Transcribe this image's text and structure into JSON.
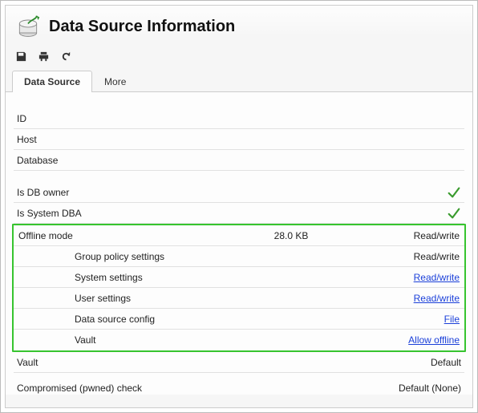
{
  "header": {
    "title": "Data Source Information"
  },
  "tabs": {
    "data_source": "Data Source",
    "more": "More"
  },
  "fields": {
    "id_label": "ID",
    "host_label": "Host",
    "database_label": "Database",
    "is_db_owner_label": "Is DB owner",
    "is_system_dba_label": "Is System DBA",
    "vault_label": "Vault",
    "vault_value": "Default",
    "pwned_label": "Compromised (pwned) check",
    "pwned_value": "Default (None)"
  },
  "offline": {
    "label": "Offline mode",
    "size": "28.0 KB",
    "mode": "Read/write",
    "rows": [
      {
        "label": "Group policy settings",
        "value": "Read/write",
        "link": false
      },
      {
        "label": "System settings",
        "value": "Read/write",
        "link": true
      },
      {
        "label": "User settings",
        "value": "Read/write",
        "link": true
      },
      {
        "label": "Data source config",
        "value": "File",
        "link": true
      },
      {
        "label": "Vault",
        "value": "Allow offline",
        "link": true
      }
    ]
  }
}
